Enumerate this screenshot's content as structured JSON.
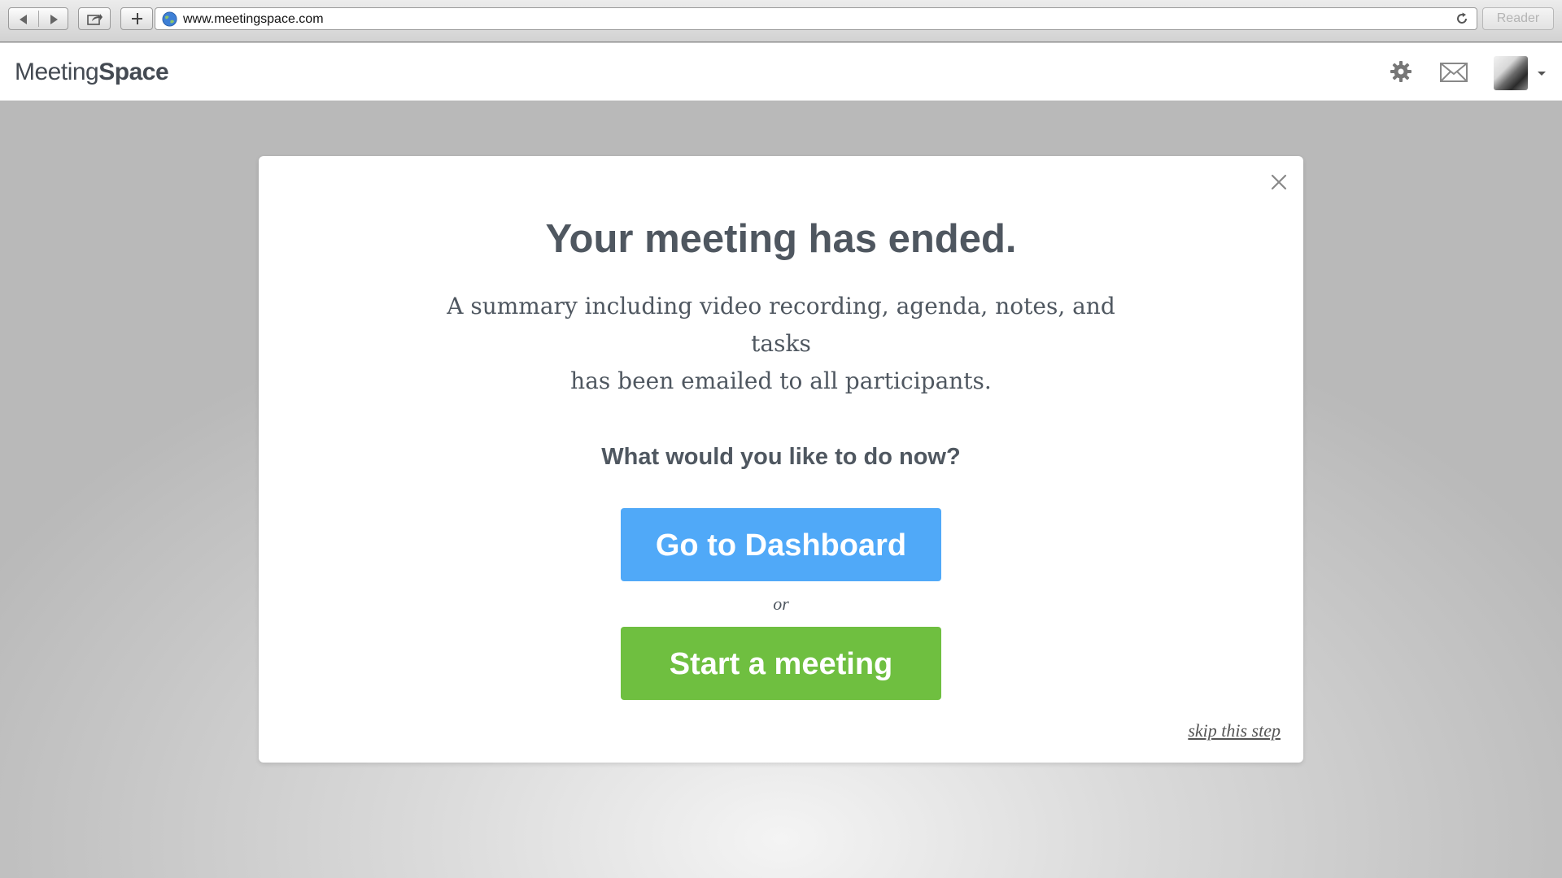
{
  "browser": {
    "url": "www.meetingspace.com",
    "reader_label": "Reader"
  },
  "header": {
    "logo_light": "Meeting",
    "logo_bold": "Space"
  },
  "modal": {
    "title": "Your meeting has ended.",
    "summary_line1": "A summary including video recording, agenda, notes, and tasks",
    "summary_line2": "has been emailed to all participants.",
    "question": "What would you like to do now?",
    "dashboard_button": "Go to Dashboard",
    "or_text": "or",
    "start_button": "Start a meeting",
    "skip_link": "skip this step"
  },
  "colors": {
    "dashboard_button": "#50a9f8",
    "start_button": "#6fbf40",
    "text": "#4f5760"
  },
  "icons": [
    "back-icon",
    "forward-icon",
    "share-icon",
    "add-icon",
    "globe-icon",
    "reload-icon",
    "gear-icon",
    "mail-icon",
    "chevron-down-icon",
    "close-icon"
  ]
}
